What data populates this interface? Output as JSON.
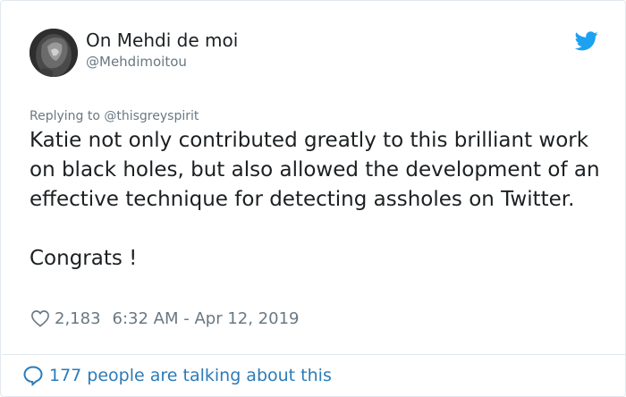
{
  "author": {
    "display_name": "On Mehdi de moi",
    "handle": "@Mehdimoitou"
  },
  "reply": {
    "text": "Replying to @thisgreyspirit"
  },
  "tweet": {
    "body": "Katie not only contributed greatly to this brilliant work on black holes, but also allowed the development of an effective technique for detecting assholes on Twitter.",
    "closing": "Congrats !"
  },
  "meta": {
    "likes": "2,183",
    "timestamp": "6:32 AM - Apr 12, 2019"
  },
  "conversation": {
    "text": "177 people are talking about this"
  },
  "colors": {
    "twitter_blue": "#1da1f2",
    "link_blue": "#2b7bb9",
    "secondary_text": "#697882",
    "primary_text": "#1c2022",
    "border": "#e1e8ed"
  },
  "icons": {
    "brand": "twitter-bird-icon",
    "like": "heart-icon",
    "conversation": "speech-bubble-icon"
  }
}
